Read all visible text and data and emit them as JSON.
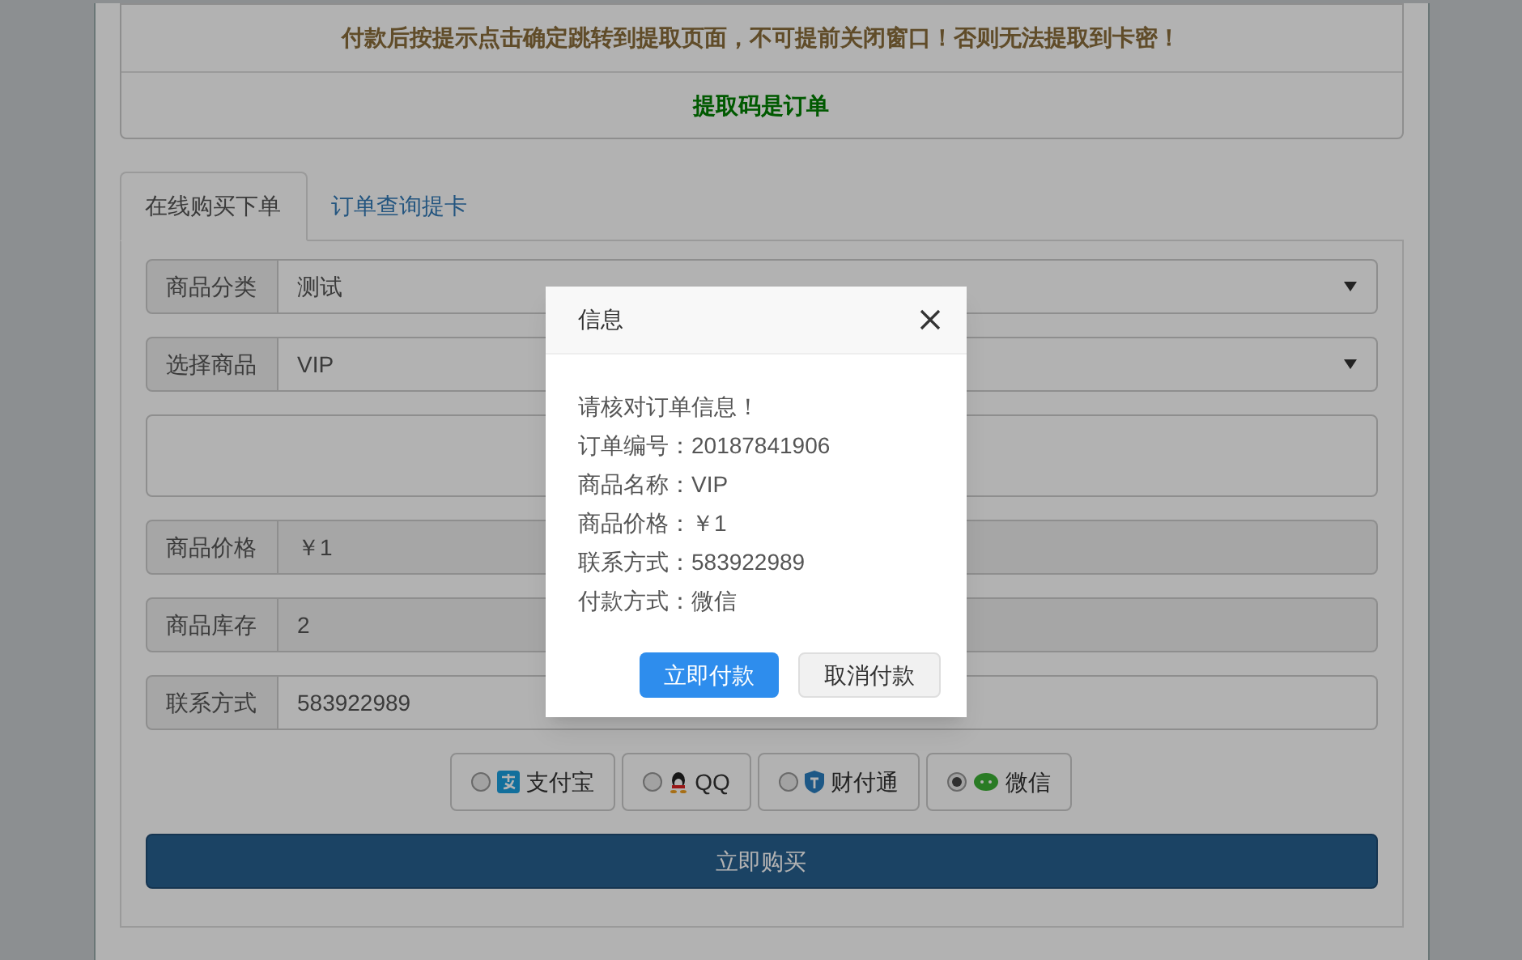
{
  "notice": [
    {
      "kind": "warning",
      "text": "付款后按提示点击确定跳转到提取页面，不可提前关闭窗口！否则无法提取到卡密！"
    },
    {
      "kind": "code",
      "text": "提取码是订单"
    }
  ],
  "tabs": [
    {
      "label": "在线购买下单",
      "selected": true
    },
    {
      "label": "订单查询提卡",
      "selected": false
    }
  ],
  "form": [
    {
      "kind": "select",
      "label": "商品分类",
      "value": "测试"
    },
    {
      "kind": "select",
      "label": "选择商品",
      "value": "VIP"
    },
    {
      "kind": "textarea"
    },
    {
      "kind": "readonly",
      "label": "商品价格",
      "value": "￥1"
    },
    {
      "kind": "readonly",
      "label": "商品库存",
      "value": "2"
    },
    {
      "kind": "text",
      "label": "联系方式",
      "value": "583922989"
    }
  ],
  "payments": [
    {
      "kind": "alipay",
      "label": "支付宝",
      "selected": false
    },
    {
      "kind": "qq",
      "label": "QQ",
      "selected": false
    },
    {
      "kind": "tenpay",
      "label": "财付通",
      "selected": false
    },
    {
      "kind": "wechat",
      "label": "微信",
      "selected": true
    }
  ],
  "buy_button": "立即购买",
  "dialog": {
    "title": "信息",
    "lines": [
      "请核对订单信息！",
      "订单编号：20187841906",
      "商品名称：VIP",
      "商品价格：￥1",
      "联系方式：583922989",
      "付款方式：微信"
    ],
    "buttons": [
      {
        "kind": "primary",
        "label": "立即付款"
      },
      {
        "kind": "secondary",
        "label": "取消付款"
      }
    ]
  }
}
